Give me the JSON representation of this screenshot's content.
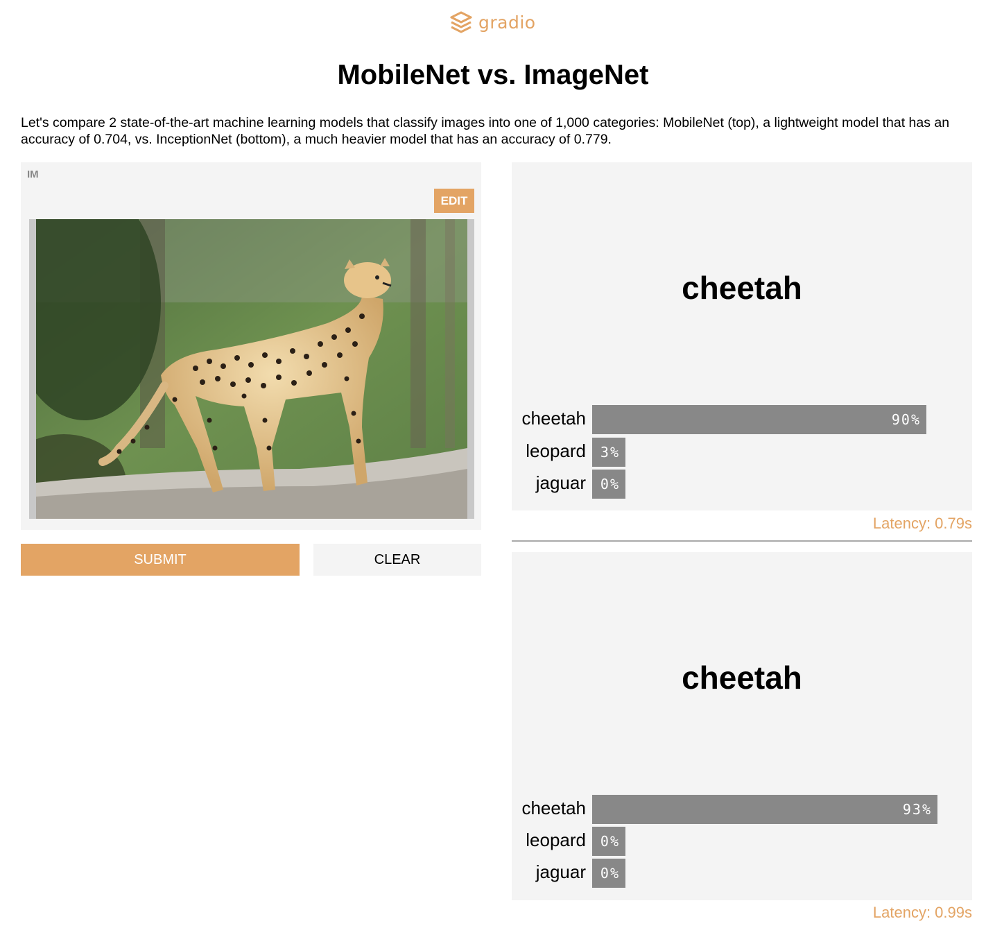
{
  "brand": {
    "name": "gradio",
    "color": "#e3a464",
    "icon": "gradio-logo-icon"
  },
  "page": {
    "title": "MobileNet vs. ImageNet",
    "description": "Let's compare 2 state-of-the-art machine learning models that classify images into one of 1,000 categories: MobileNet (top), a lightweight model that has an accuracy of 0.704, vs. InceptionNet (bottom), a much heavier model that has an accuracy of 0.779."
  },
  "input": {
    "label": "IM",
    "edit_label": "EDIT",
    "image": "cheetah-standing-on-log"
  },
  "actions": {
    "submit_label": "SUBMIT",
    "clear_label": "CLEAR"
  },
  "outputs": [
    {
      "label": "cheetah",
      "confidences": [
        {
          "name": "cheetah",
          "value": 0.9,
          "text": "90%"
        },
        {
          "name": "leopard",
          "value": 0.03,
          "text": "3%"
        },
        {
          "name": "jaguar",
          "value": 0.0,
          "text": "0%"
        }
      ],
      "latency": "Latency: 0.79s"
    },
    {
      "label": "cheetah",
      "confidences": [
        {
          "name": "cheetah",
          "value": 0.93,
          "text": "93%"
        },
        {
          "name": "leopard",
          "value": 0.0,
          "text": "0%"
        },
        {
          "name": "jaguar",
          "value": 0.0,
          "text": "0%"
        }
      ],
      "latency": "Latency: 0.99s"
    }
  ]
}
